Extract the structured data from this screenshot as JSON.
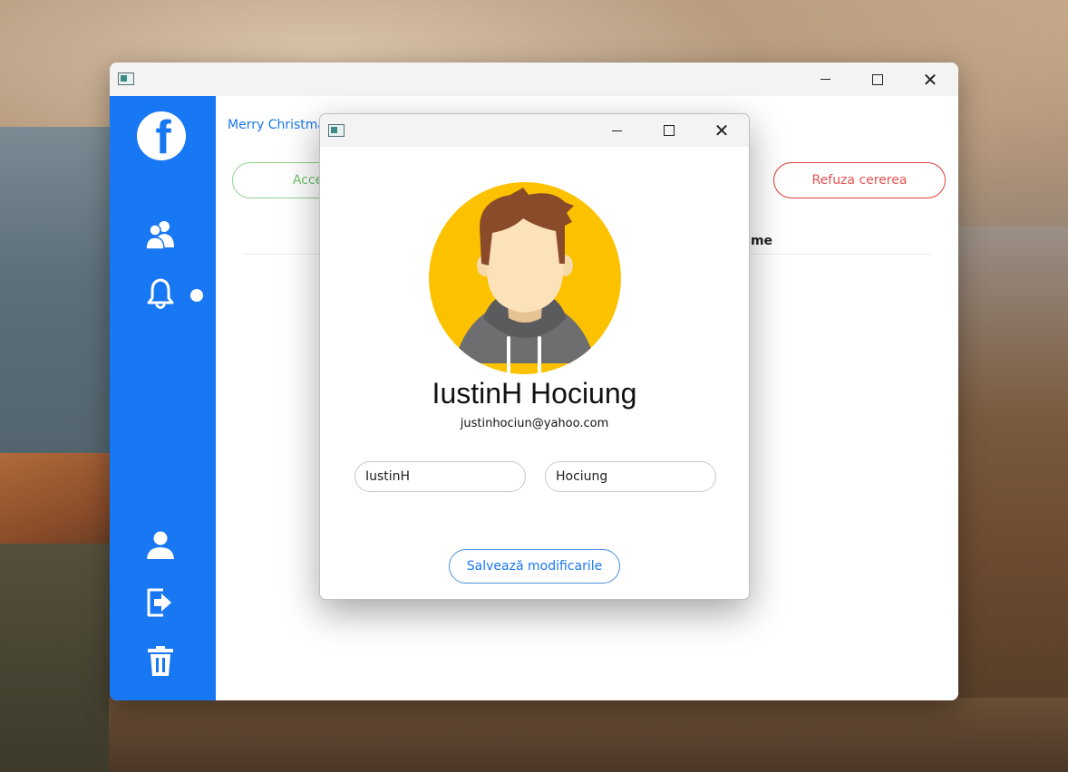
{
  "main_window": {
    "close_glyph": "✕"
  },
  "sidebar": {
    "logo_letter": "f",
    "icons": [
      "friends-icon",
      "bell-icon",
      "user-icon",
      "logout-icon",
      "trash-icon"
    ],
    "accent_color": "#1877f2"
  },
  "content": {
    "merry_text": "Merry Christma",
    "accept_label": "Accepta",
    "refuse_label": "Refuza cererea",
    "column_header": "ume"
  },
  "dialog": {
    "close_glyph": "✕",
    "profile_name": "IustinH Hociung",
    "email": "justinhociun@yahoo.com",
    "first_name_value": "IustinH",
    "last_name_value": "Hociung",
    "save_label": "Salvează modificarile"
  },
  "colors": {
    "accent": "#1877f2",
    "accept": "#6fc16b",
    "refuse": "#e35252",
    "avatar_bg": "#fcc200"
  }
}
